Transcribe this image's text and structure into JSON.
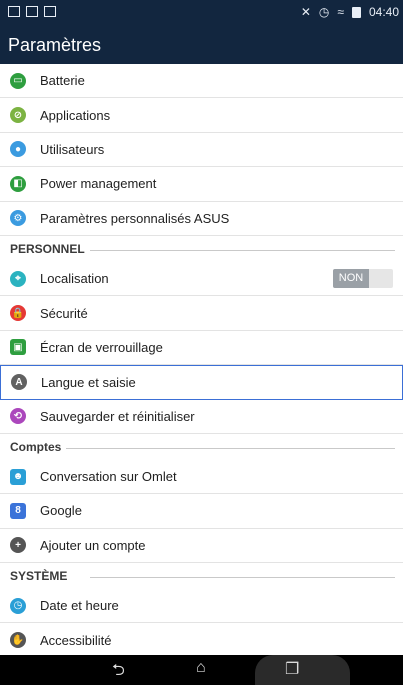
{
  "status": {
    "time": "04:40"
  },
  "app": {
    "title": "Paramètres"
  },
  "items_top": [
    {
      "label": "Batterie",
      "icon": "battery-icon",
      "color": "#2e9e3f"
    },
    {
      "label": "Applications",
      "icon": "apps-icon",
      "color": "#7cb342"
    },
    {
      "label": "Utilisateurs",
      "icon": "users-icon",
      "color": "#3b9be0"
    },
    {
      "label": "Power management",
      "icon": "power-icon",
      "color": "#2e9e3f"
    },
    {
      "label": "Paramètres personnalisés ASUS",
      "icon": "asus-icon",
      "color": "#3b9be0"
    }
  ],
  "section_personnel": "PERSONNEL",
  "items_personnel": [
    {
      "label": "Localisation",
      "icon": "location-icon",
      "color": "#2bb3c0",
      "toggle": "NON"
    },
    {
      "label": "Sécurité",
      "icon": "lock-icon",
      "color": "#e53935"
    },
    {
      "label": "Écran de verrouillage",
      "icon": "lockscreen-icon",
      "color": "#2e9e3f"
    },
    {
      "label": "Langue et saisie",
      "icon": "language-icon",
      "color": "#616161"
    },
    {
      "label": "Sauvegarder et réinitialiser",
      "icon": "backup-icon",
      "color": "#ab47bc"
    }
  ],
  "section_comptes": "Comptes",
  "items_comptes": [
    {
      "label": "Conversation sur Omlet",
      "icon": "omlet-icon",
      "color": "#2a9fd6"
    },
    {
      "label": "Google",
      "icon": "google-icon",
      "color": "#3b73d9"
    },
    {
      "label": "Ajouter un compte",
      "icon": "add-icon",
      "color": "#555555"
    }
  ],
  "section_systeme": "SYSTÈME",
  "items_systeme": [
    {
      "label": "Date et heure",
      "icon": "clock-icon",
      "color": "#2a9fd6"
    },
    {
      "label": "Accessibilité",
      "icon": "accessibility-icon",
      "color": "#555555"
    }
  ]
}
